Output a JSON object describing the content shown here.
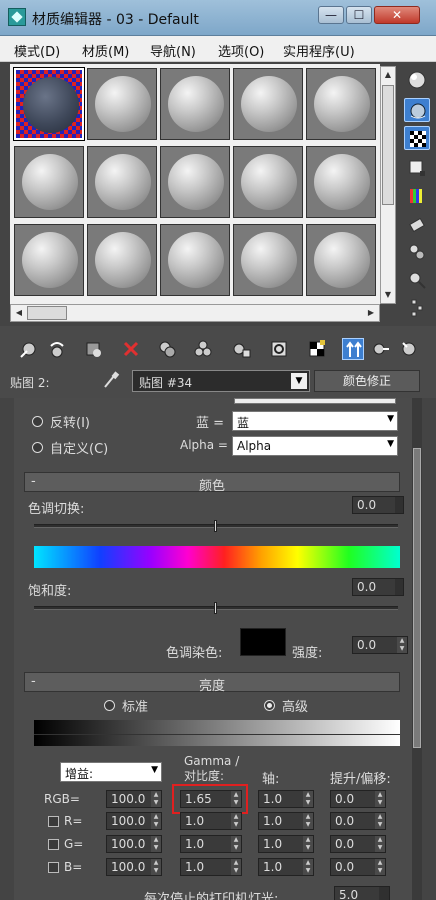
{
  "window": {
    "title": "材质编辑器 - 03 - Default",
    "min_label": "—",
    "max_label": "☐",
    "close_label": "✕"
  },
  "menu": [
    "模式(D)",
    "材质(M)",
    "导航(N)",
    "选项(O)",
    "实用程序(U)"
  ],
  "map_row": {
    "label": "贴图 2:",
    "dropdown_value": "贴图 #34",
    "color_correct_button": "颜色修正"
  },
  "channels": {
    "invert_label": "反转(I)",
    "custom_label": "自定义(C)",
    "blue_label": "蓝 =",
    "blue_value": "蓝",
    "alpha_label": "Alpha =",
    "alpha_value": "Alpha"
  },
  "color_section": {
    "title": "颜色",
    "hue_shift_label": "色调切换:",
    "hue_shift_value": "0.0",
    "saturation_label": "饱和度:",
    "saturation_value": "0.0",
    "tint_label": "色调染色:",
    "tint_color": "#000000",
    "strength_label": "强度:",
    "strength_value": "0.0"
  },
  "brightness_section": {
    "title": "亮度",
    "standard_label": "标准",
    "advanced_label": "高级",
    "gain_dropdown": "增益:",
    "gamma_header": "Gamma /\n对比度:",
    "pivot_header": "轴:",
    "lift_header": "提升/偏移:",
    "rows": [
      {
        "label": "RGB=",
        "gain": "100.0",
        "gamma": "1.65",
        "pivot": "1.0",
        "lift": "0.0"
      },
      {
        "label": "R=",
        "gain": "100.0",
        "gamma": "1.0",
        "pivot": "1.0",
        "lift": "0.0"
      },
      {
        "label": "G=",
        "gain": "100.0",
        "gamma": "1.0",
        "pivot": "1.0",
        "lift": "0.0"
      },
      {
        "label": "B=",
        "gain": "100.0",
        "gamma": "1.0",
        "pivot": "1.0",
        "lift": "0.0"
      }
    ],
    "printer_lights_label": "每次停止的打印机灯光:",
    "printer_lights_value": "5.0"
  },
  "colors": {
    "highlight": "#e02020",
    "active_tool": "#3d7fd0"
  }
}
